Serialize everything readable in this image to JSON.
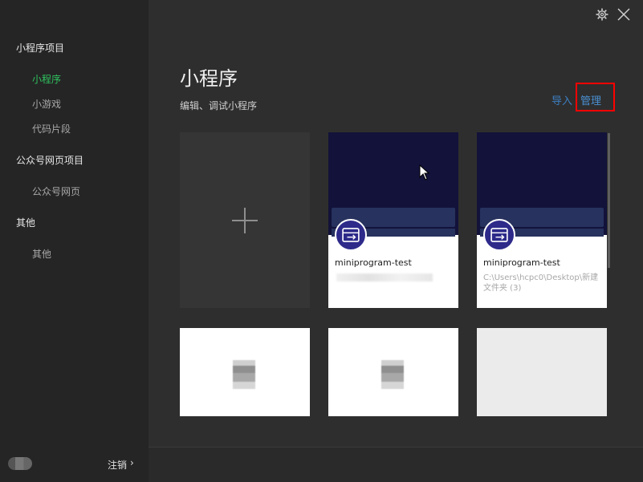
{
  "sidebar": {
    "sections": [
      {
        "title": "小程序项目",
        "items": [
          "小程序",
          "小游戏",
          "代码片段"
        ]
      },
      {
        "title": "公众号网页项目",
        "items": [
          "公众号网页"
        ]
      },
      {
        "title": "其他",
        "items": [
          "其他"
        ]
      }
    ],
    "active_item": "小程序",
    "logout_label": "注销",
    "logout_chevron": "›"
  },
  "header": {
    "title": "小程序",
    "subtitle": "编辑、调试小程序",
    "import_label": "导入",
    "manage_label": "管理"
  },
  "projects": [
    {
      "name": "miniprogram-test",
      "path": ""
    },
    {
      "name": "miniprogram-test",
      "path": "C:\\Users\\hcpc0\\Desktop\\新建文件夹 (3)"
    }
  ],
  "icons": {
    "settings": "gear-icon",
    "close": "close-icon",
    "new_project": "plus-icon",
    "project": "mini-program-icon"
  },
  "colors": {
    "accent_green": "#2fc35f",
    "link_blue": "#4a8fd1",
    "highlight_red": "#ff0000"
  }
}
